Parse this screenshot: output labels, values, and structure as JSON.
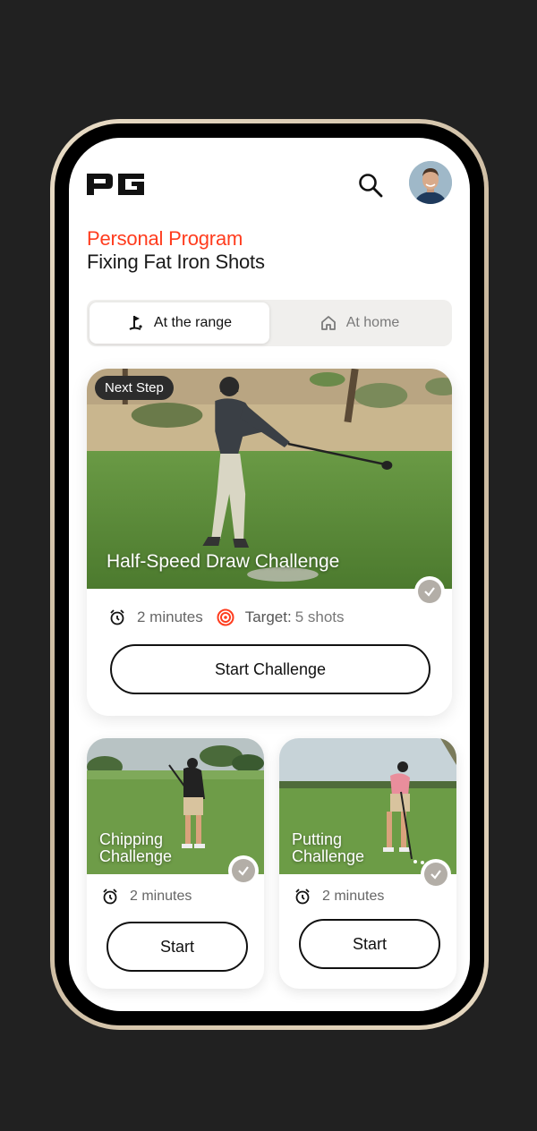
{
  "header": {
    "logo_text": "PG",
    "search_icon": "search-icon",
    "avatar_icon": "avatar"
  },
  "program": {
    "label": "Personal Program",
    "title": "Fixing Fat Iron Shots"
  },
  "tabs": [
    {
      "label": "At the range",
      "icon": "golf-flag-icon",
      "active": true
    },
    {
      "label": "At home",
      "icon": "home-icon",
      "active": false
    }
  ],
  "featured": {
    "badge": "Next Step",
    "title": "Half-Speed Draw Challenge",
    "duration": "2 minutes",
    "target_label": "Target:",
    "target_value": "5 shots",
    "button": "Start Challenge",
    "completed_icon": "check-icon"
  },
  "cards": [
    {
      "title": "Chipping Challenge",
      "duration": "2 minutes",
      "button": "Start"
    },
    {
      "title": "Putting Challenge",
      "duration": "2 minutes",
      "button": "Start"
    }
  ],
  "colors": {
    "accent": "#ff3c1e",
    "background": "#212121",
    "text": "#1a1a1a"
  }
}
